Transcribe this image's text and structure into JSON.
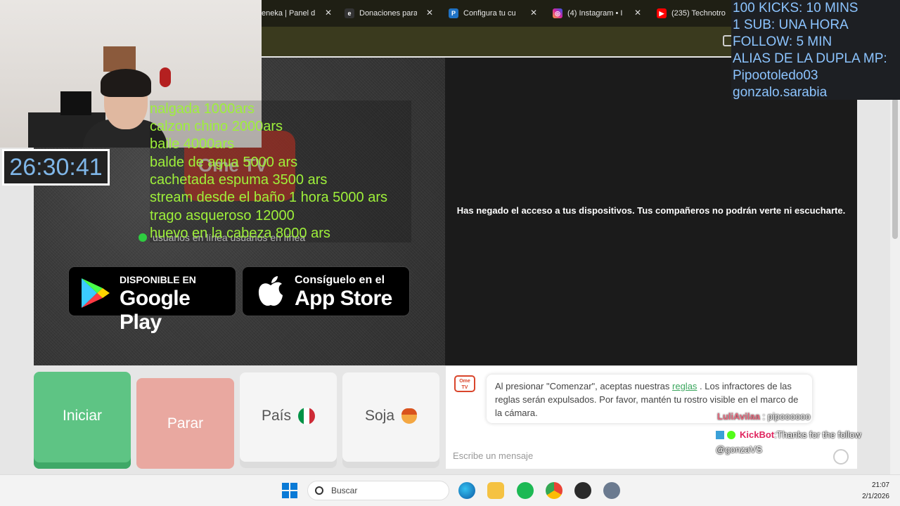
{
  "browser": {
    "tabs": [
      {
        "title": "eneka | Panel d",
        "icon": "page-icon",
        "color": "#6c6c6c"
      },
      {
        "title": "Donaciones para",
        "icon": "cafecito-icon",
        "color": "#ffffff"
      },
      {
        "title": "Configura tu cu",
        "icon": "paypal-icon",
        "color": "#1f72c4"
      },
      {
        "title": "(4) Instagram • I",
        "icon": "instagram-icon",
        "color": "#d6249f"
      },
      {
        "title": "(235) Technotro",
        "icon": "youtube-icon",
        "color": "#ff0000"
      }
    ]
  },
  "omegle": {
    "logo_text": "Ome TV",
    "online_text": "usuarios en línea usuarios en línea",
    "google_play": {
      "small": "DISPONIBLE EN",
      "big": "Google Play"
    },
    "app_store": {
      "small": "Consíguelo en el",
      "big": "App Store"
    },
    "denied_message": "Has negado el acceso a tus dispositivos. Tus compañeros no podrán verte ni escucharte.",
    "buttons": {
      "start": "Iniciar",
      "stop": "Parar",
      "country": "País",
      "gender": "Soja"
    },
    "rules_prefix": "Al presionar \"Comenzar\", aceptas nuestras ",
    "rules_link": "reglas",
    "rules_suffix": " . Los infractores de las reglas serán expulsados. Por favor, mantén tu rostro visible en el marco de la cámara.",
    "message_placeholder": "Escribe un mensaje",
    "bot_icon_text": "Ome TV"
  },
  "overlay": {
    "timer": "26:30:41",
    "price_list": [
      "nalgada 1000ars",
      "calzon chino 2000ars",
      "baile 4000ars",
      "balde de agua 5000 ars",
      "cachetada espuma 3500 ars",
      "stream desde el baño 1 hora 5000 ars",
      "trago asqueroso 12000",
      "huevo en la cabeza 8000 ars"
    ],
    "info_lines": [
      "100 KICKS: 10 MINS",
      "1 SUB: UNA HORA",
      "FOLLOW: 5 MIN",
      "ALIAS DE LA DUPLA MP:",
      "Pipootoledo03",
      "gonzalo.sarabia"
    ],
    "chat": [
      {
        "user": "LuliAvilaa",
        "sep": " : ",
        "text": "pipoooooo",
        "color": "#e8697e"
      },
      {
        "user": "KickBot",
        "sep": " : ",
        "text": "Thanks for the follow",
        "color": "#e0245e"
      }
    ],
    "chat_tail": "@gonzaVS"
  },
  "taskbar": {
    "search": "Buscar",
    "time": "21:07",
    "date": "2/1/2026",
    "apps": [
      "edge-icon",
      "file-explorer-icon",
      "spotify-icon",
      "chrome-icon",
      "obs-icon",
      "settings-icon"
    ]
  }
}
